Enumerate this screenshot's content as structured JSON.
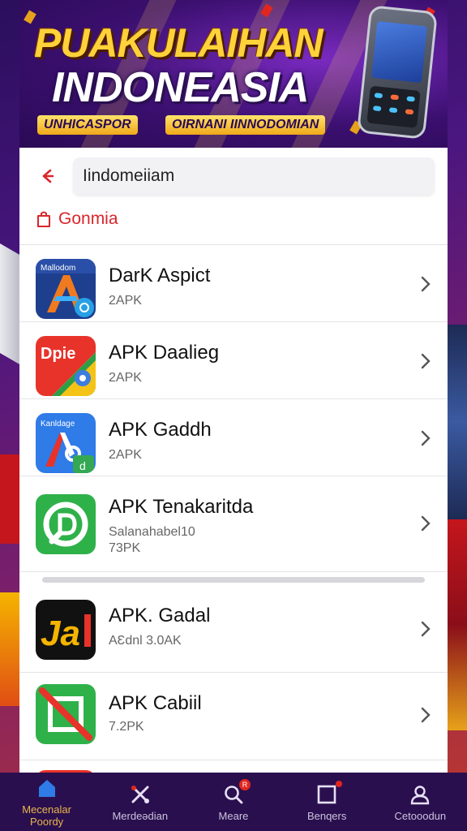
{
  "banner": {
    "title": "PUAKULAIHAN",
    "subtitle": "INDONEASIA",
    "tag_left": "UNHICASPOR",
    "tag_right": "OIRNANI IINNODOMIAN"
  },
  "search": {
    "value": "Iindomeiiam",
    "placeholder": ""
  },
  "category": {
    "label": "Gonmia"
  },
  "apps": [
    {
      "name": "DarK Aspict",
      "meta": "2APK",
      "meta2": "",
      "icon": "A-arrow-icon"
    },
    {
      "name": "APK Daalieg",
      "meta": "2APK",
      "meta2": "",
      "icon": "dpie-icon"
    },
    {
      "name": "APK Gaddh",
      "meta": "2APK",
      "meta2": "",
      "icon": "gaddh-icon"
    },
    {
      "name": "APK Tenakaritda",
      "meta": "Salanahabel10",
      "meta2": "73PK",
      "icon": "d-circle-icon"
    },
    {
      "name": "APK. Gadal",
      "meta": "AƐdnl 3.0AK",
      "meta2": "",
      "icon": "ja-icon"
    },
    {
      "name": "APK Cabiil",
      "meta": "7.2PK",
      "meta2": "",
      "icon": "slash-square-icon"
    }
  ],
  "nav": {
    "items": [
      {
        "label_line1": "Mecenalar",
        "label_line2": "Poordy",
        "icon": "home-icon"
      },
      {
        "label_line1": "Merdeədian",
        "label_line2": "",
        "icon": "tools-icon"
      },
      {
        "label_line1": "Meare",
        "label_line2": "",
        "icon": "search-icon",
        "badge": "R"
      },
      {
        "label_line1": "Benqers",
        "label_line2": "",
        "icon": "square-icon"
      },
      {
        "label_line1": "Cetooodun",
        "label_line2": "",
        "icon": "user-icon"
      }
    ]
  },
  "colors": {
    "accent_red": "#d9262b",
    "nav_bg": "#2a0f4f",
    "banner_gold": "#ffd23a"
  }
}
